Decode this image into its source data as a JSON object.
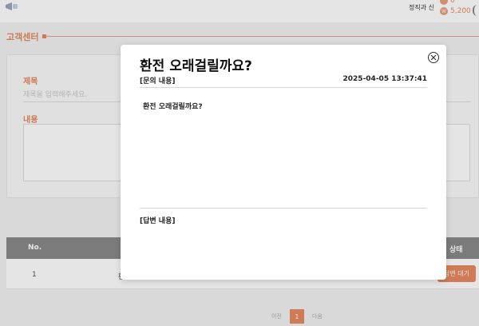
{
  "header": {
    "top_link": "정직과 신",
    "coin_top_value": "0",
    "coin_bottom_value": "5,200",
    "coin_glyph": "W"
  },
  "page": {
    "section_title": "고객센터",
    "form": {
      "title_label": "제목",
      "title_placeholder": "제목을 입력해주세요.",
      "content_label": "내용"
    },
    "table": {
      "headers": {
        "no": "No.",
        "state": "상태"
      },
      "rows": [
        {
          "no": "1",
          "title": "환",
          "state": "답변 대기"
        }
      ]
    },
    "pager": {
      "prev": "이전",
      "current": "1",
      "next": "다음"
    }
  },
  "modal": {
    "title": "환전 오래걸릴까요?",
    "question_label": "[문의 내용]",
    "question_date": "2025-04-05 13:37:41",
    "question_body": "환전 오래걸릴까요?",
    "answer_label": "[답변 내용]",
    "answer_body": ""
  },
  "colors": {
    "accent": "#e78a5f",
    "table_header": "#8a8a8a"
  }
}
